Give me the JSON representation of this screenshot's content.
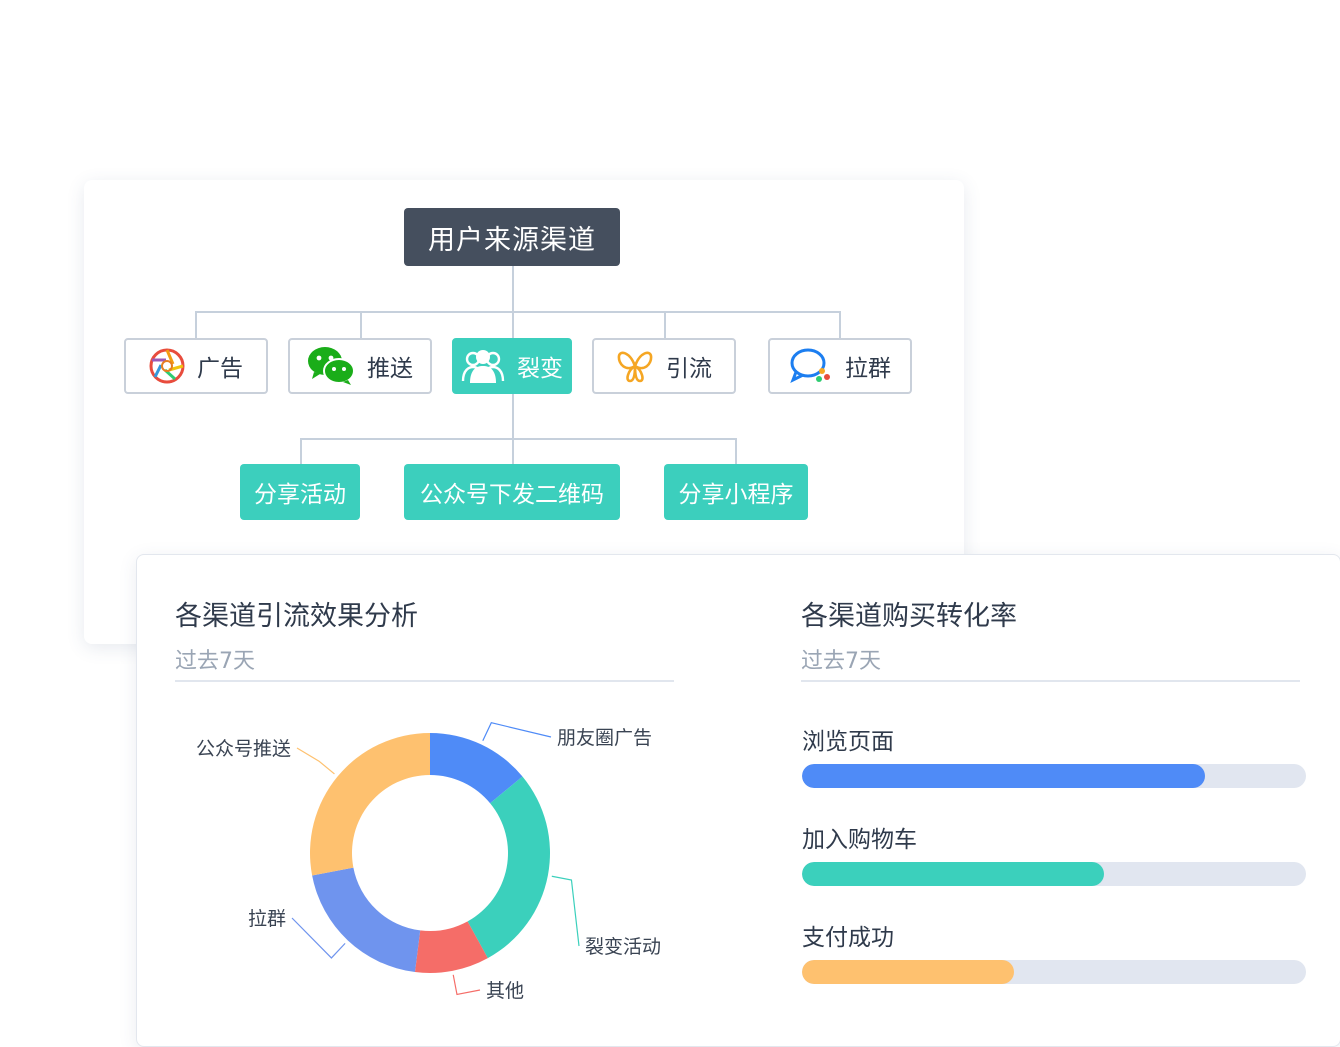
{
  "diagram": {
    "root": "用户来源渠道",
    "channels": [
      {
        "label": "广告",
        "icon": "aperture-icon"
      },
      {
        "label": "推送",
        "icon": "wechat-icon"
      },
      {
        "label": "裂变",
        "icon": "users-icon"
      },
      {
        "label": "引流",
        "icon": "butterfly-icon"
      },
      {
        "label": "拉群",
        "icon": "chat-bubble-icon"
      }
    ],
    "sub_items": [
      "分享活动",
      "公众号下发二维码",
      "分享小程序"
    ]
  },
  "left_panel": {
    "title": "各渠道引流效果分析",
    "subtitle": "过去7天"
  },
  "right_panel": {
    "title": "各渠道购买转化率",
    "subtitle": "过去7天"
  },
  "chart_data": [
    {
      "type": "pie",
      "variant": "donut",
      "title": "各渠道引流效果分析",
      "subtitle": "过去7天",
      "slices": [
        {
          "label": "朋友圈广告",
          "value": 14,
          "color": "#4f8bf7"
        },
        {
          "label": "裂变活动",
          "value": 28,
          "color": "#3bd0bc"
        },
        {
          "label": "其他",
          "value": 10,
          "color": "#f56d68"
        },
        {
          "label": "拉群",
          "value": 20,
          "color": "#6f94ee"
        },
        {
          "label": "公众号推送",
          "value": 28,
          "color": "#fec16f"
        }
      ]
    },
    {
      "type": "bar",
      "orientation": "horizontal",
      "title": "各渠道购买转化率",
      "subtitle": "过去7天",
      "categories": [
        "浏览页面",
        "加入购物车",
        "支付成功"
      ],
      "values": [
        0.8,
        0.6,
        0.42
      ],
      "colors": [
        "#4f8bf7",
        "#3bd0bc",
        "#fec16f"
      ],
      "track_color": "#e1e6f0"
    }
  ]
}
